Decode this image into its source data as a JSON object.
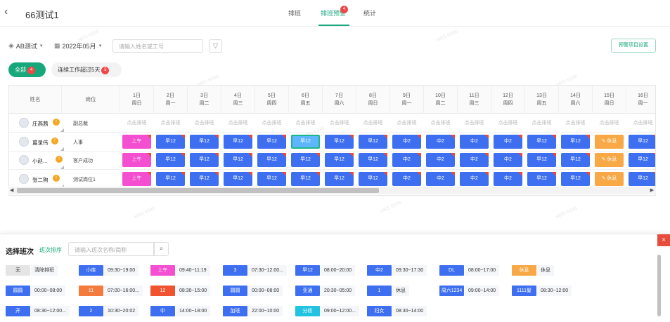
{
  "header": {
    "back_icon": "‹",
    "title": "66测试1",
    "tabs": [
      {
        "label": "排班",
        "active": false
      },
      {
        "label": "排班预警",
        "active": true,
        "badge": "4"
      },
      {
        "label": "统计",
        "active": false
      }
    ]
  },
  "toolbar": {
    "group_label": "AB测试",
    "month_label": "2022年05月",
    "search_placeholder": "请输入姓名或工号",
    "settings_label": "预警项目设置"
  },
  "filters": {
    "all_label": "全部",
    "all_count": "4",
    "over_label": "连续工作超过5天",
    "over_count": "5"
  },
  "watermark": "HRS 6336",
  "table": {
    "name_header": "姓名",
    "position_header": "岗位",
    "days": [
      {
        "date": "1日",
        "week": "周日"
      },
      {
        "date": "2日",
        "week": "周一"
      },
      {
        "date": "3日",
        "week": "周二"
      },
      {
        "date": "4日",
        "week": "周三"
      },
      {
        "date": "5日",
        "week": "周四"
      },
      {
        "date": "6日",
        "week": "周五"
      },
      {
        "date": "7日",
        "week": "周六"
      },
      {
        "date": "8日",
        "week": "周日"
      },
      {
        "date": "9日",
        "week": "周一"
      },
      {
        "date": "10日",
        "week": "周二"
      },
      {
        "date": "11日",
        "week": "周三"
      },
      {
        "date": "12日",
        "week": "周四"
      },
      {
        "date": "13日",
        "week": "周五"
      },
      {
        "date": "14日",
        "week": "周六"
      },
      {
        "date": "15日",
        "week": "周日"
      },
      {
        "date": "16日",
        "week": "周一"
      }
    ],
    "rows": [
      {
        "name": "庄燕茜",
        "position": "副总裁",
        "warn": "!",
        "cells": [
          "点击排班",
          "点击排班",
          "点击排班",
          "点击排班",
          "点击排班",
          "点击排班",
          "点击排班",
          "点击排班",
          "点击排班",
          "点击排班",
          "点击排班",
          "点击排班",
          "点击排班",
          "点击排班",
          "点击排班",
          "点击排班"
        ]
      },
      {
        "name": "葛录伟",
        "position": "人事",
        "warn": "!",
        "cells": [
          "上午",
          "早12",
          "早12",
          "早12",
          "早12",
          "早12",
          "早12",
          "早12",
          "中2",
          "中2",
          "中2",
          "中2",
          "早12",
          "早12",
          "休息",
          "早12"
        ]
      },
      {
        "name": "小赵...",
        "position": "客户成功",
        "warn": "!",
        "cells": [
          "上午",
          "早12",
          "早12",
          "早12",
          "早12",
          "早12",
          "早12",
          "早12",
          "中2",
          "中2",
          "中2",
          "中2",
          "早12",
          "早12",
          "休息",
          "早12"
        ]
      },
      {
        "name": "张二狗",
        "position": "测试岗位1",
        "warn": "!",
        "cells": [
          "上午",
          "早12",
          "早12",
          "早12",
          "早12",
          "早12",
          "早12",
          "早12",
          "中2",
          "中2",
          "中2",
          "中2",
          "早12",
          "早12",
          "休息",
          "早12"
        ]
      }
    ],
    "selected_cell_note": "6日 of row 2 highlighted",
    "scroll_left": "◀",
    "scroll_right": "▶"
  },
  "panel": {
    "title": "选择班次",
    "sort_label": "班次排序",
    "search_placeholder": "请输入班次名称/简称",
    "search_icon": "⌕",
    "close_icon": "×",
    "shifts": [
      {
        "tag": "无",
        "time": "清除排班",
        "color": "#e5e5e5",
        "text": "#333"
      },
      {
        "tag": "小库",
        "time": "09:30~19:00",
        "color": "#3d6ff0",
        "text": "#fff"
      },
      {
        "tag": "上午",
        "time": "09:40~11:19",
        "color": "#f44fd0",
        "text": "#fff"
      },
      {
        "tag": "3",
        "time": "07:30~12:00...",
        "color": "#3d6ff0",
        "text": "#fff"
      },
      {
        "tag": "早12",
        "time": "08:00~20:00",
        "color": "#3d6ff0",
        "text": "#fff"
      },
      {
        "tag": "中2",
        "time": "09:30~17:30",
        "color": "#3d6ff0",
        "text": "#fff"
      },
      {
        "tag": "DL",
        "time": "08:00~17:00",
        "color": "#3d6ff0",
        "text": "#fff"
      },
      {
        "tag": "休息",
        "time": "休息",
        "color": "#f8a845",
        "text": "#fff"
      },
      {
        "tag": "圆圆",
        "time": "00:00~08:00",
        "color": "#3d6ff0",
        "text": "#fff"
      },
      {
        "tag": "11",
        "time": "07:00~16:00...",
        "color": "#f47a3d",
        "text": "#fff"
      },
      {
        "tag": "12",
        "time": "08:30~15:00",
        "color": "#f0532f",
        "text": "#fff"
      },
      {
        "tag": "圆圆",
        "time": "00:00~08:00",
        "color": "#3d6ff0",
        "text": "#fff"
      },
      {
        "tag": "亚通",
        "time": "20:30~05:00",
        "color": "#3d6ff0",
        "text": "#fff"
      },
      {
        "tag": "1",
        "time": "休息",
        "color": "#3d6ff0",
        "text": "#fff"
      },
      {
        "tag": "周六1234",
        "time": "09:00~14:00",
        "color": "#3d6ff0",
        "text": "#fff"
      },
      {
        "tag": "1111髮",
        "time": "08:30~12:00",
        "color": "#3d6ff0",
        "text": "#fff"
      },
      {
        "tag": "开",
        "time": "08:30~12:00...",
        "color": "#3d6ff0",
        "text": "#fff"
      },
      {
        "tag": "2",
        "time": "10:30~20:02",
        "color": "#3d6ff0",
        "text": "#fff"
      },
      {
        "tag": "中",
        "time": "14:00~18:00",
        "color": "#3d6ff0",
        "text": "#fff"
      },
      {
        "tag": "加班",
        "time": "22:00~10:00",
        "color": "#3d6ff0",
        "text": "#fff"
      },
      {
        "tag": "分段",
        "time": "09:00~12:00...",
        "color": "#21c3e0",
        "text": "#fff"
      },
      {
        "tag": "妇女",
        "time": "08:30~14:00",
        "color": "#3d6ff0",
        "text": "#fff"
      }
    ]
  }
}
